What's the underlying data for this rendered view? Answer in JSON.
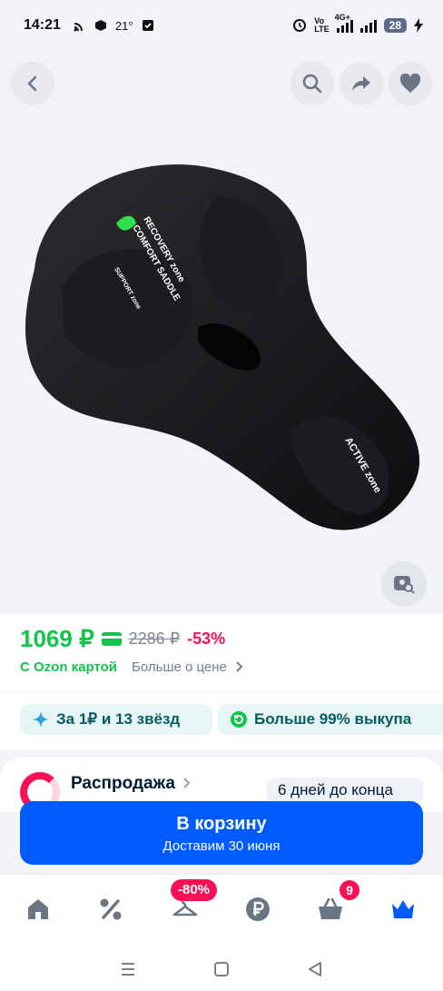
{
  "status_bar": {
    "time": "14:21",
    "temperature": "21°",
    "network_top": "Vo",
    "network_bottom": "LTE",
    "signal_label": "4G+",
    "battery": "28"
  },
  "gallery": {
    "saddle_texts": [
      "RECOVERY zone",
      "COMFORT SADDLE",
      "SUPPORT zone",
      "ACTIVE zone"
    ]
  },
  "price": {
    "current": "1069 ₽",
    "old": "2286 ₽",
    "discount": "-53%",
    "with_card": "С Ozon картой",
    "more_link": "Больше о цене"
  },
  "chips": [
    {
      "label": "За 1₽ и 13 звёзд",
      "icon": "sparkle-icon"
    },
    {
      "label": "Больше 99% выкупа",
      "icon": "return-icon"
    }
  ],
  "sale": {
    "title": "Распродажа",
    "days_left": "6 дней до конца"
  },
  "cart_button": {
    "label": "В корзину",
    "delivery": "Доставим 30 июня"
  },
  "bottom_nav": {
    "badge_discount": "-80%",
    "cart_count": "9"
  },
  "colors": {
    "accent": "#005bff",
    "price_green": "#10c44c",
    "discount_pink": "#f91155"
  }
}
